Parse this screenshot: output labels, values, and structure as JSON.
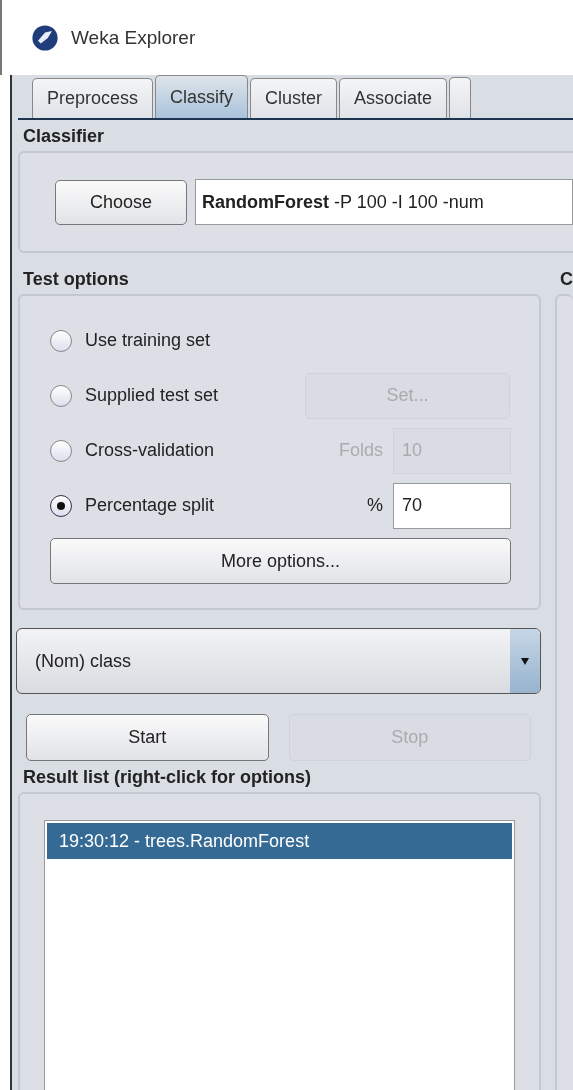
{
  "window": {
    "title": "Weka Explorer"
  },
  "tabs": [
    {
      "label": "Preprocess",
      "selected": false
    },
    {
      "label": "Classify",
      "selected": true
    },
    {
      "label": "Cluster",
      "selected": false
    },
    {
      "label": "Associate",
      "selected": false
    }
  ],
  "classifier": {
    "heading": "Classifier",
    "button": "Choose",
    "command": "**RandomForest** -P 100 -I 100 -num"
  },
  "test_options": {
    "heading": "Test options",
    "options": [
      {
        "kind": "plain",
        "label": "Use training set",
        "selected": false
      },
      {
        "kind": "button",
        "label": "Supplied test set",
        "selected": false,
        "button": {
          "label": "Set...",
          "disabled": true
        }
      },
      {
        "kind": "field",
        "label": "Cross-validation",
        "selected": false,
        "field_label": "Folds",
        "value": "10",
        "disabled": true
      },
      {
        "kind": "field",
        "label": "Percentage split",
        "selected": true,
        "field_label": "%",
        "value": "70",
        "disabled": false
      }
    ],
    "more_button": "More options..."
  },
  "class_select": {
    "value": "(Nom) class"
  },
  "start_button": {
    "label": "Start",
    "disabled": false
  },
  "stop_button": {
    "label": "Stop",
    "disabled": true
  },
  "result_list": {
    "heading": "Result list (right-click for options)",
    "items": [
      {
        "text": "19:30:12 - trees.RandomForest",
        "selected": true
      }
    ]
  },
  "output_panel": {
    "heading": "C"
  }
}
